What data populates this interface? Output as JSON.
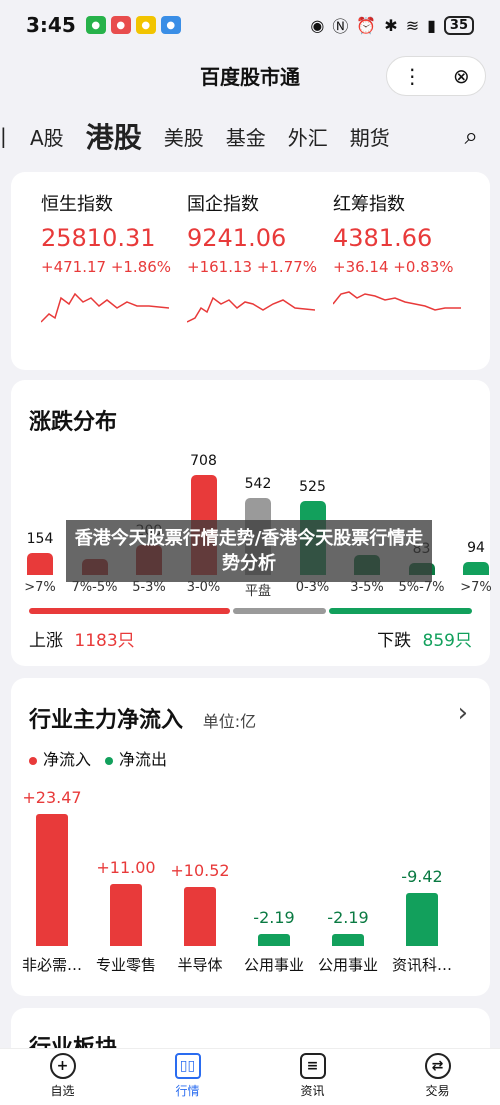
{
  "status": {
    "time": "3:45",
    "battery": "35"
  },
  "header": {
    "title": "百度股市通",
    "more_icon": "more-dots-icon",
    "close_icon": "close-icon"
  },
  "tabs": [
    {
      "label": "A股",
      "active": false
    },
    {
      "label": "港股",
      "active": true
    },
    {
      "label": "美股",
      "active": false
    },
    {
      "label": "基金",
      "active": false
    },
    {
      "label": "外汇",
      "active": false
    },
    {
      "label": "期货",
      "active": false
    }
  ],
  "indices": [
    {
      "name": "恒生指数",
      "value": "25810.31",
      "change": "+471.17 +1.86%"
    },
    {
      "name": "国企指数",
      "value": "9241.06",
      "change": "+161.13 +1.77%"
    },
    {
      "name": "红筹指数",
      "value": "4381.66",
      "change": "+36.14 +0.83%"
    }
  ],
  "distribution": {
    "title": "涨跌分布",
    "up_label": "上涨",
    "up_count": "1183只",
    "down_label": "下跌",
    "down_count": "859只"
  },
  "overlay_text": "香港今天股票行情走势/香港今天股票行情走势分析",
  "flow": {
    "title": "行业主力净流入",
    "unit": "单位:亿",
    "legend_in": "净流入",
    "legend_out": "净流出"
  },
  "next_section_title": "行业板块",
  "nav": [
    {
      "label": "自选",
      "icon": "plus-icon"
    },
    {
      "label": "行情",
      "icon": "candlestick-icon"
    },
    {
      "label": "资讯",
      "icon": "news-icon"
    },
    {
      "label": "交易",
      "icon": "exchange-icon"
    }
  ],
  "colors": {
    "up": "#e83a3a",
    "down": "#12a05c",
    "flat": "#9a9a9a",
    "accent": "#2a6cf0"
  },
  "chart_data": [
    {
      "type": "bar",
      "title": "涨跌分布",
      "categories": [
        ">7%",
        "7%-5%",
        "5-3%",
        "3-0%",
        "平盘",
        "0-3%",
        "3-5%",
        "5%-7%",
        ">7%"
      ],
      "values": [
        154,
        112,
        209,
        708,
        542,
        525,
        140,
        83,
        94
      ],
      "value_labels": [
        "154",
        "",
        "209",
        "708",
        "542",
        "525",
        "",
        "83",
        "94"
      ]
    },
    {
      "type": "bar",
      "title": "行业主力净流入",
      "categories": [
        "非必需…",
        "专业零售",
        "半导体",
        "公用事业",
        "公用事业",
        "资讯科…"
      ],
      "values": [
        23.47,
        11.0,
        10.52,
        -2.19,
        -2.19,
        -9.42
      ],
      "value_labels": [
        "+23.47",
        "+11.00",
        "+10.52",
        "-2.19",
        "-2.19",
        "-9.42"
      ]
    }
  ]
}
